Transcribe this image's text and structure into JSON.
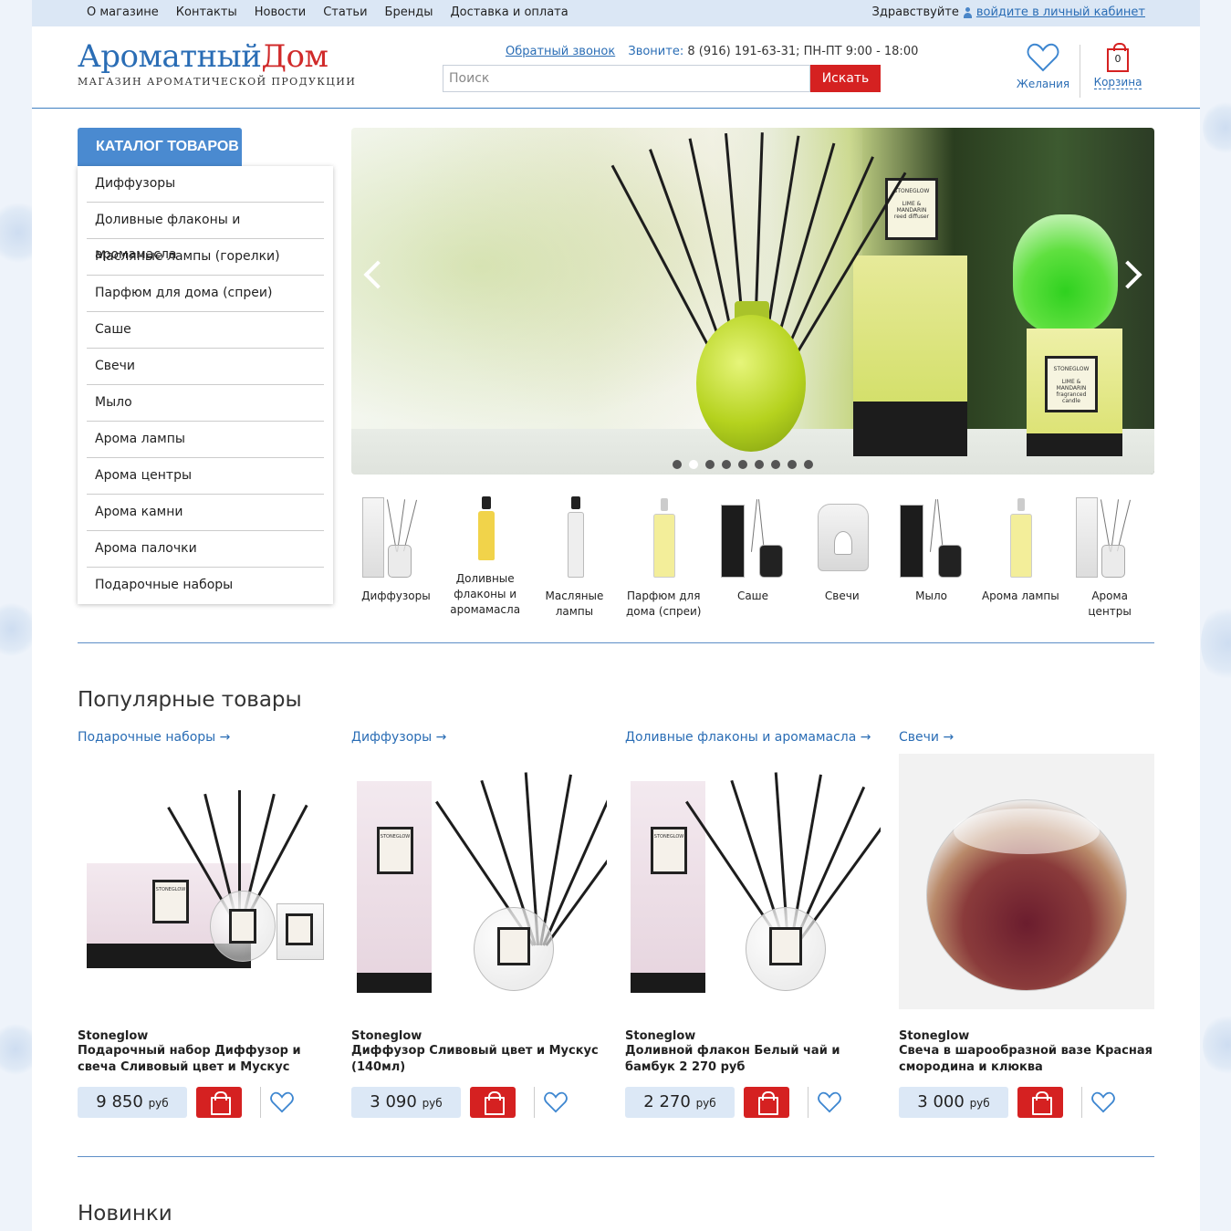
{
  "topnav": [
    "О магазине",
    "Контакты",
    "Новости",
    "Статьи",
    "Бренды",
    "Доставка и оплата"
  ],
  "greeting": "Здравствуйте",
  "login_link": "войдите в личный кабинет",
  "logo": {
    "part1": "Ароматный",
    "part2": "Дом",
    "subtitle": "МАГАЗИН АРОМАТИЧЕСКОЙ ПРОДУКЦИИ"
  },
  "contact": {
    "callback": "Обратный звонок",
    "call_label": "Звоните:",
    "phone": "8 (916) 191-63-31;",
    "hours": "ПН-ПТ 9:00 - 18:00"
  },
  "search": {
    "placeholder": "Поиск",
    "button": "Искать"
  },
  "wishlist_label": "Желания",
  "cart": {
    "label": "Корзина",
    "count": "0"
  },
  "catalog_title": "КАТАЛОГ ТОВАРОВ",
  "catalog": [
    "Диффузоры",
    "Доливные флаконы и аромамасла",
    "Масляные лампы (горелки)",
    "Парфюм для дома (спреи)",
    "Саше",
    "Свечи",
    "Мыло",
    "Арома лампы",
    "Арома центры",
    "Арома камни",
    "Арома палочки",
    "Подарочные наборы"
  ],
  "slider": {
    "label_top": "STONEGLOW",
    "label_1": "LIME & MANDARIN",
    "label_1b": "reed diffuser",
    "label_2": "LIME & MANDARIN",
    "label_2b": "fragranced candle",
    "slides": 9,
    "active": 2
  },
  "thumbs": [
    "Диффузоры",
    "Доливные флаконы и аромамасла",
    "Масляные лампы",
    "Парфюм для дома (спреи)",
    "Саше",
    "Свечи",
    "Мыло",
    "Арома лампы",
    "Арома центры"
  ],
  "popular_title": "Популярные товары",
  "products": [
    {
      "category": "Подарочные наборы →",
      "brand": "Stoneglow",
      "name": "Подарочный набор Диффузор и свеча Сливовый цвет и Мускус",
      "price": "9 850",
      "currency": "руб"
    },
    {
      "category": "Диффузоры →",
      "brand": "Stoneglow",
      "name": "Диффузор Сливовый цвет и Мускус (140мл)",
      "price": "3 090",
      "currency": "руб"
    },
    {
      "category": "Доливные флаконы и аромамасла →",
      "brand": "Stoneglow",
      "name": "Доливной флакон Белый чай и бамбук 2 270 руб",
      "price": "2 270",
      "currency": "руб"
    },
    {
      "category": "Свечи →",
      "brand": "Stoneglow",
      "name": "Свеча в шарообразной вазе Красная смородина и клюква",
      "price": "3 000",
      "currency": "руб"
    }
  ],
  "new_title": "Новинки",
  "colors": {
    "accent_blue": "#2a6db5",
    "brand_red": "#d52121",
    "topbar": "#dbe7f5",
    "price_bg": "#dce8f6"
  }
}
